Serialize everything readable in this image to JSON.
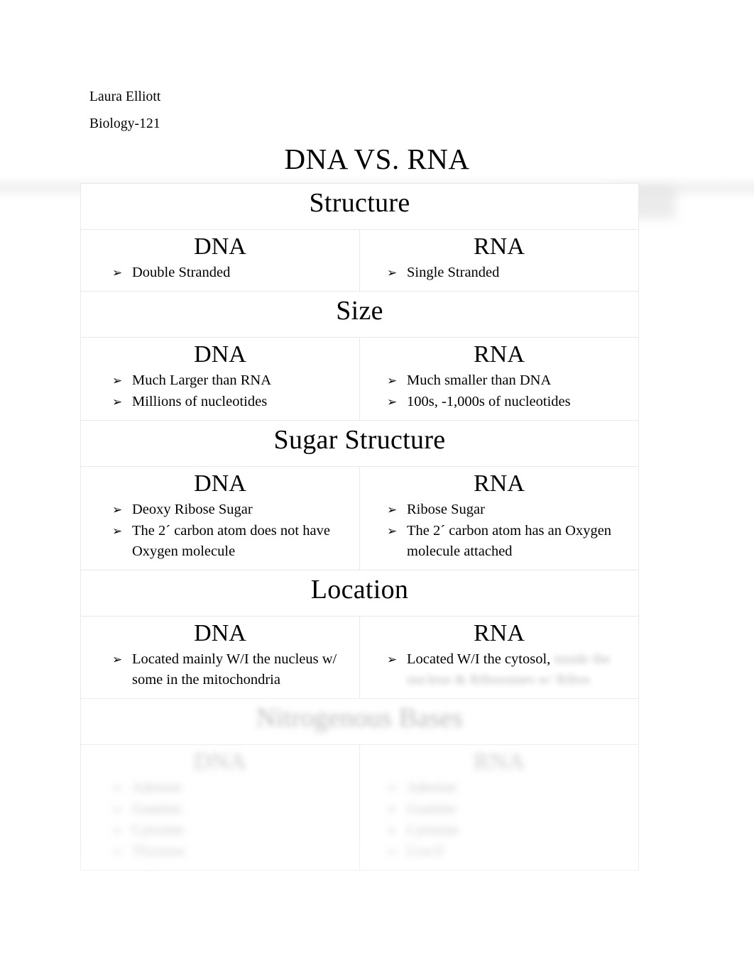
{
  "document": {
    "author": "Laura Elliott",
    "course": "Biology-121",
    "title": "DNA VS. RNA"
  },
  "bullet_marker": "➢",
  "column_headers": {
    "dna": "DNA",
    "rna": "RNA"
  },
  "sections": [
    {
      "heading": "Structure",
      "dna_header": "DNA",
      "rna_header": "RNA",
      "dna_items": [
        "Double Stranded"
      ],
      "rna_items": [
        "Single Stranded"
      ]
    },
    {
      "heading": "Size",
      "dna_header": "DNA",
      "rna_header": "RNA",
      "dna_items": [
        "Much Larger than RNA",
        "Millions of nucleotides"
      ],
      "rna_items": [
        "Much smaller than DNA",
        "100s, -1,000s of nucleotides"
      ]
    },
    {
      "heading": "Sugar Structure",
      "dna_header": "DNA",
      "rna_header": "RNA",
      "dna_items": [
        "Deoxy Ribose Sugar",
        "The 2´ carbon atom does not have Oxygen molecule"
      ],
      "rna_items": [
        "Ribose Sugar",
        "The 2´ carbon atom has an Oxygen molecule attached"
      ]
    },
    {
      "heading": "Location",
      "dna_header": "DNA",
      "rna_header": "RNA",
      "dna_items": [
        "Located mainly W/I the nucleus w/ some in the mitochondria"
      ],
      "rna_items": [
        "Located W/I the cytosol, inside the nucleus & Ribosomes w/ Ribos"
      ]
    },
    {
      "heading": "Nitrogenous Bases",
      "dna_header": "DNA",
      "rna_header": "RNA",
      "dna_items": [
        "Adenine",
        "Guanine",
        "Cytosine",
        "Thymine"
      ],
      "rna_items": [
        "Adenine",
        "Guanine",
        "Cytosine",
        "Uracil"
      ]
    }
  ],
  "colors": {
    "text": "#000000",
    "page_background": "#ffffff",
    "table_border": "#e9e9e9"
  }
}
